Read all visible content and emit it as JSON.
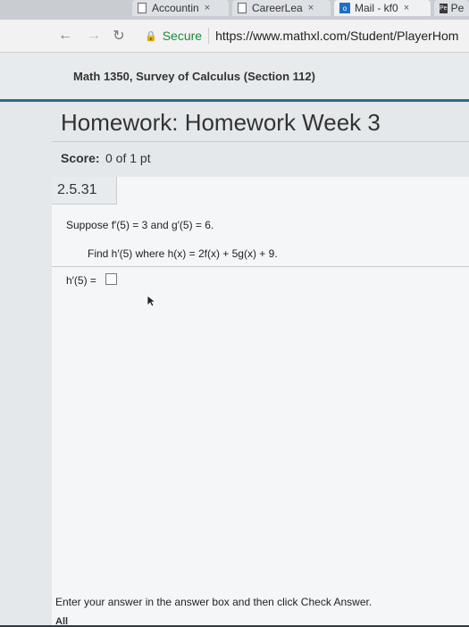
{
  "browser": {
    "tabs": [
      {
        "label": "Accountin"
      },
      {
        "label": "CareerLea"
      },
      {
        "label": "Mail - kf0"
      },
      {
        "label": "Pe"
      }
    ],
    "tab_close": "×",
    "secure_label": "Secure",
    "url": "https://www.mathxl.com/Student/PlayerHom"
  },
  "page": {
    "course_title": "Math 1350, Survey of Calculus (Section 112)",
    "homework_title": "Homework: Homework Week 3",
    "score_label": "Score:",
    "score_value": "0 of 1 pt",
    "question_number": "2.5.31",
    "question_line1": "Suppose f′(5) = 3 and g′(5) = 6.",
    "question_line2": "Find h′(5) where h(x) = 2f(x) + 5g(x) + 9.",
    "answer_label": "h′(5) =",
    "instructions": "Enter your answer in the answer box and then click Check Answer.",
    "footer_partial": "All"
  },
  "colors": {
    "accent": "#2f6b8a",
    "secure_green": "#1a8a3b"
  }
}
